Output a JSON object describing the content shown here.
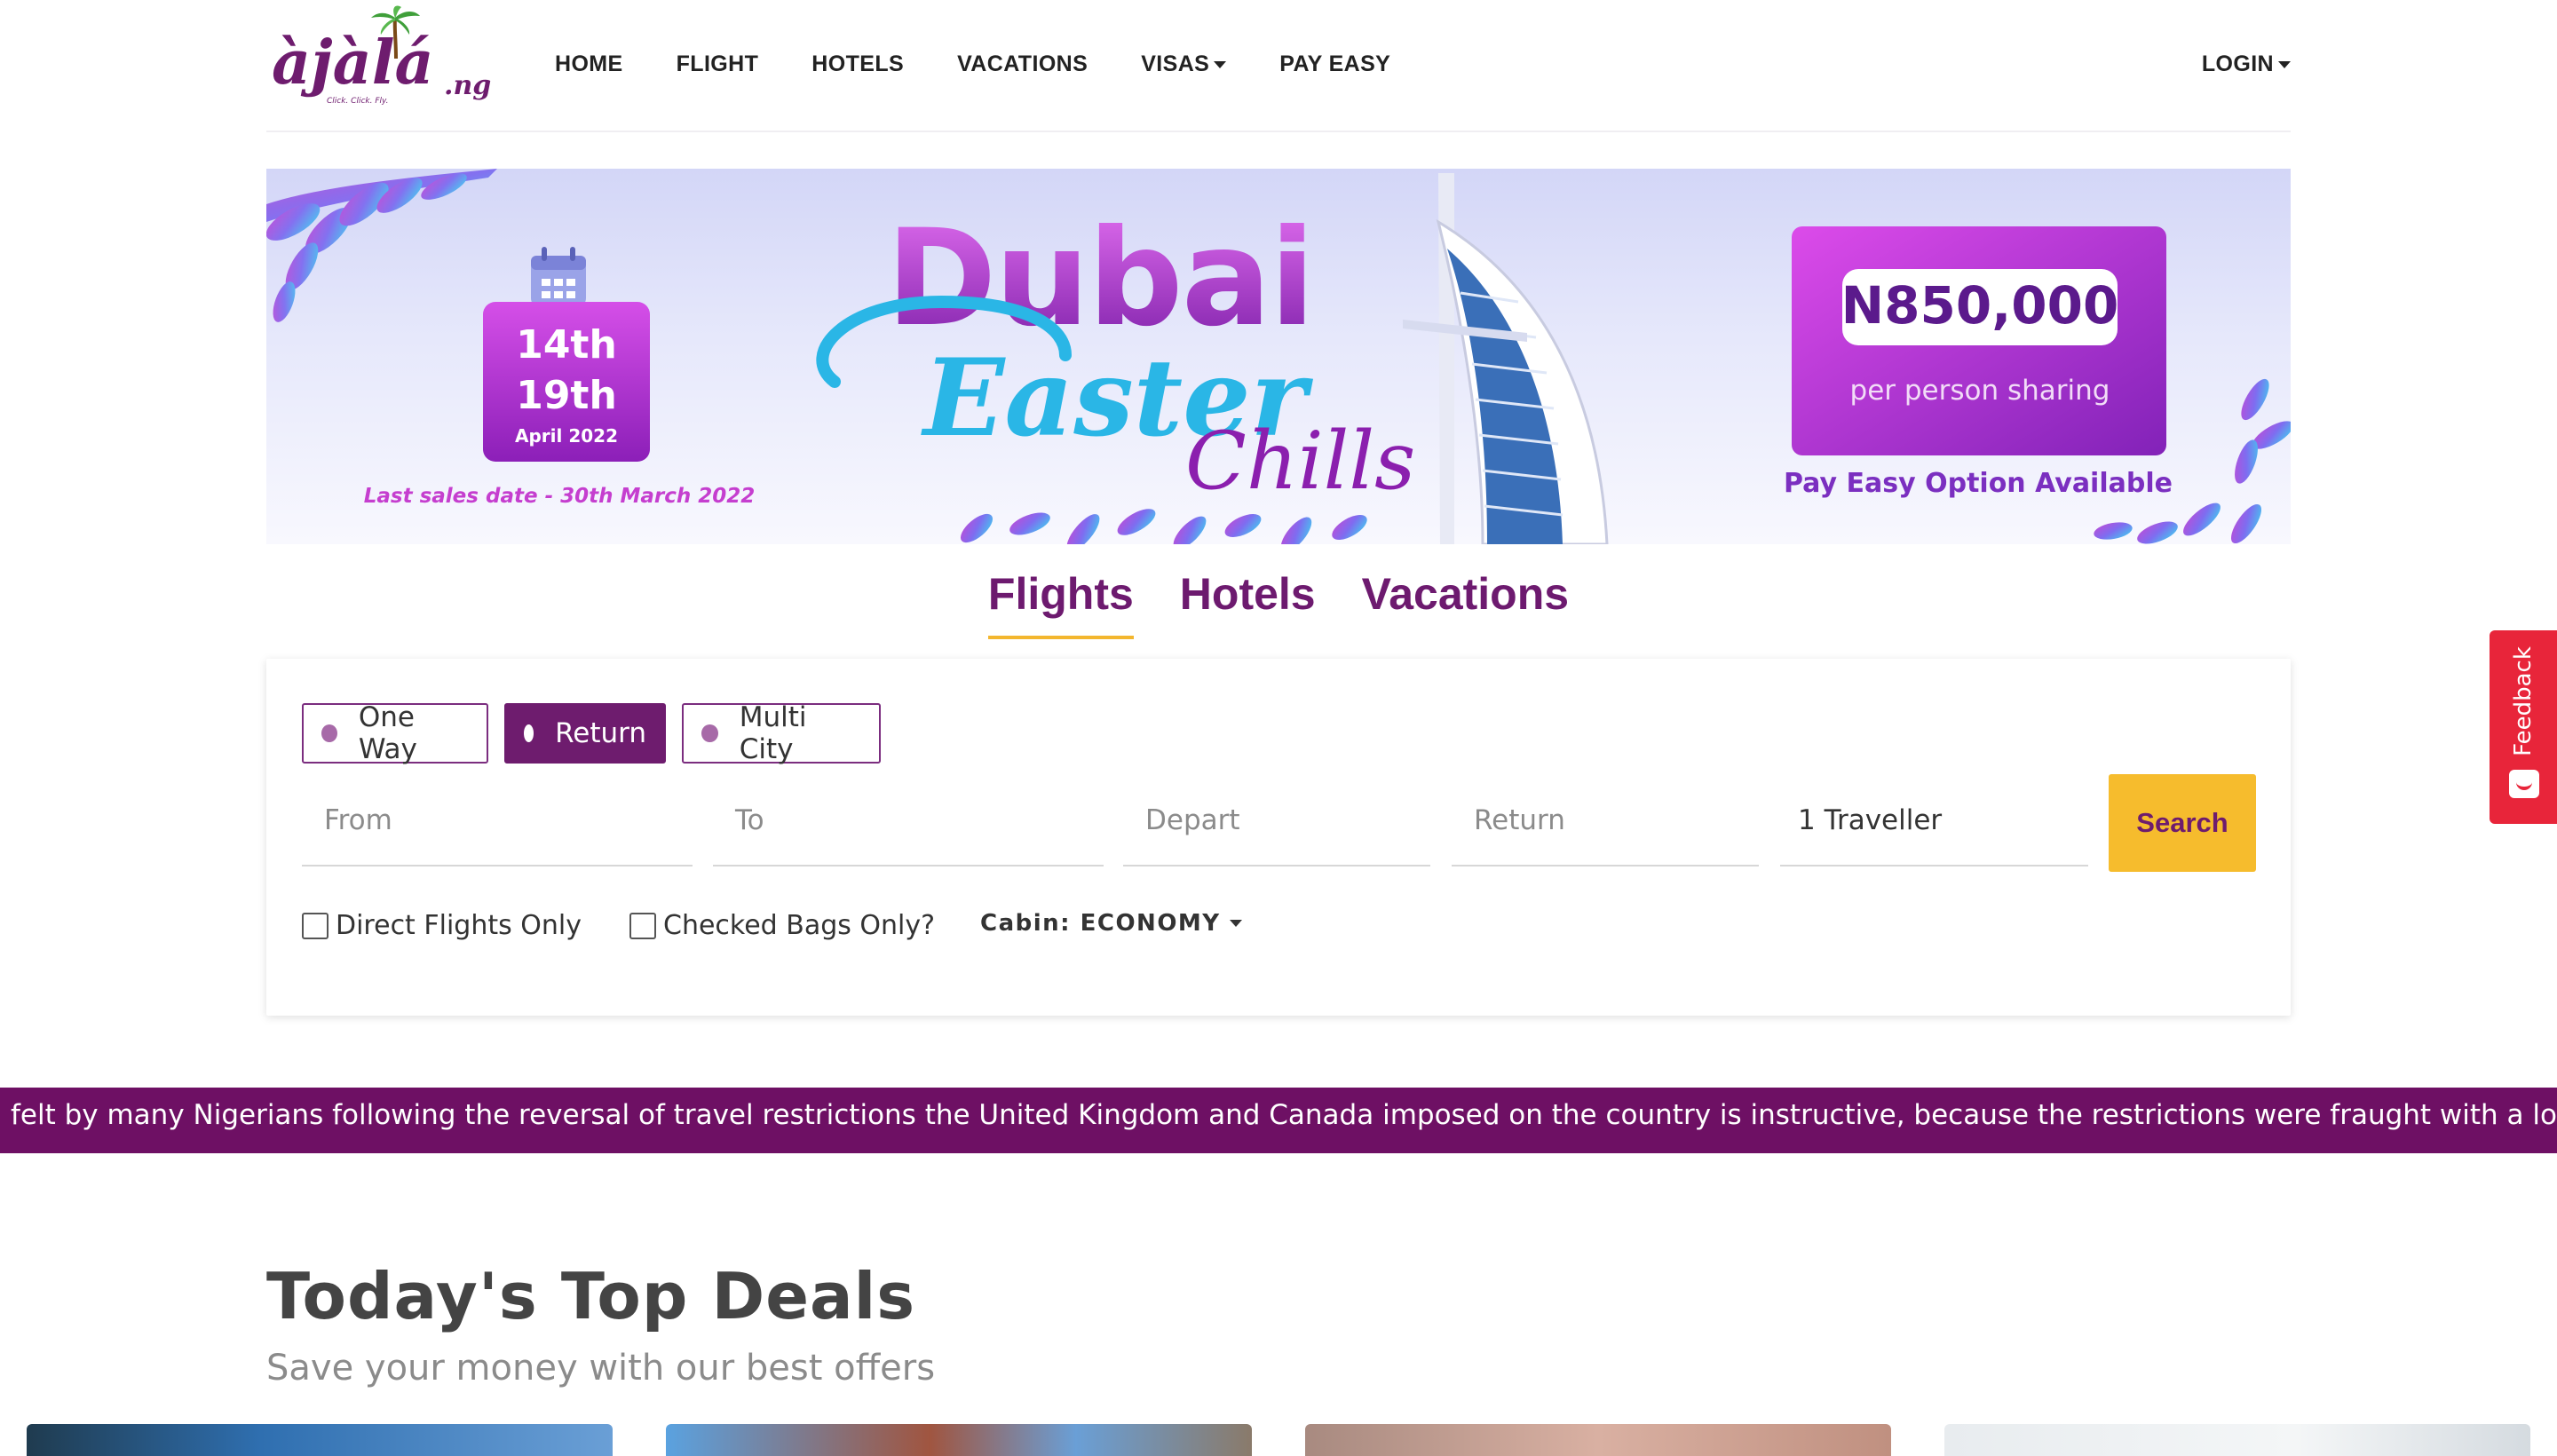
{
  "brand": {
    "logo_text": "àjàlá",
    "logo_suffix": ".ng",
    "logo_tagline": "Click. Click. Fly."
  },
  "nav": {
    "items": [
      {
        "label": "HOME"
      },
      {
        "label": "FLIGHT"
      },
      {
        "label": "HOTELS"
      },
      {
        "label": "VACATIONS"
      },
      {
        "label": "VISAS",
        "dropdown": true
      },
      {
        "label": "PAY EASY"
      }
    ],
    "login": "LOGIN"
  },
  "banner": {
    "dates_line1": "14th",
    "dates_line2": "19th",
    "dates_month": "April 2022",
    "last_sales": "Last sales date - 30th March 2022",
    "headline": "Dubai",
    "script_word1": "Easter",
    "script_word2": "Chills",
    "price": "N850,000",
    "price_note": "per person sharing",
    "pay_easy": "Pay Easy Option Available"
  },
  "tabs": [
    {
      "label": "Flights",
      "active": true
    },
    {
      "label": "Hotels",
      "active": false
    },
    {
      "label": "Vacations",
      "active": false
    }
  ],
  "search": {
    "trip_types": [
      {
        "label": "One Way",
        "active": false
      },
      {
        "label": "Return",
        "active": true
      },
      {
        "label": "Multi City",
        "active": false
      }
    ],
    "fields": {
      "from": "From",
      "to": "To",
      "depart": "Depart",
      "return": "Return",
      "travellers": "1 Traveller"
    },
    "search_label": "Search",
    "direct_flights": "Direct Flights Only",
    "checked_bags": "Checked Bags Only?",
    "cabin": "Cabin: ECONOMY"
  },
  "ticker": {
    "text": "felt by many Nigerians following the reversal of travel restrictions the United Kingdom and Canada imposed on the country is instructive, because the restrictions were fraught with a lot of complications and"
  },
  "deals": {
    "title": "Today's Top Deals",
    "subtitle": "Save your money with our best offers"
  },
  "feedback": {
    "label": "Feedback"
  },
  "colors": {
    "brand_purple": "#6e1c6e",
    "accent_yellow": "#f6bc2d",
    "feedback_red": "#e8253a"
  }
}
